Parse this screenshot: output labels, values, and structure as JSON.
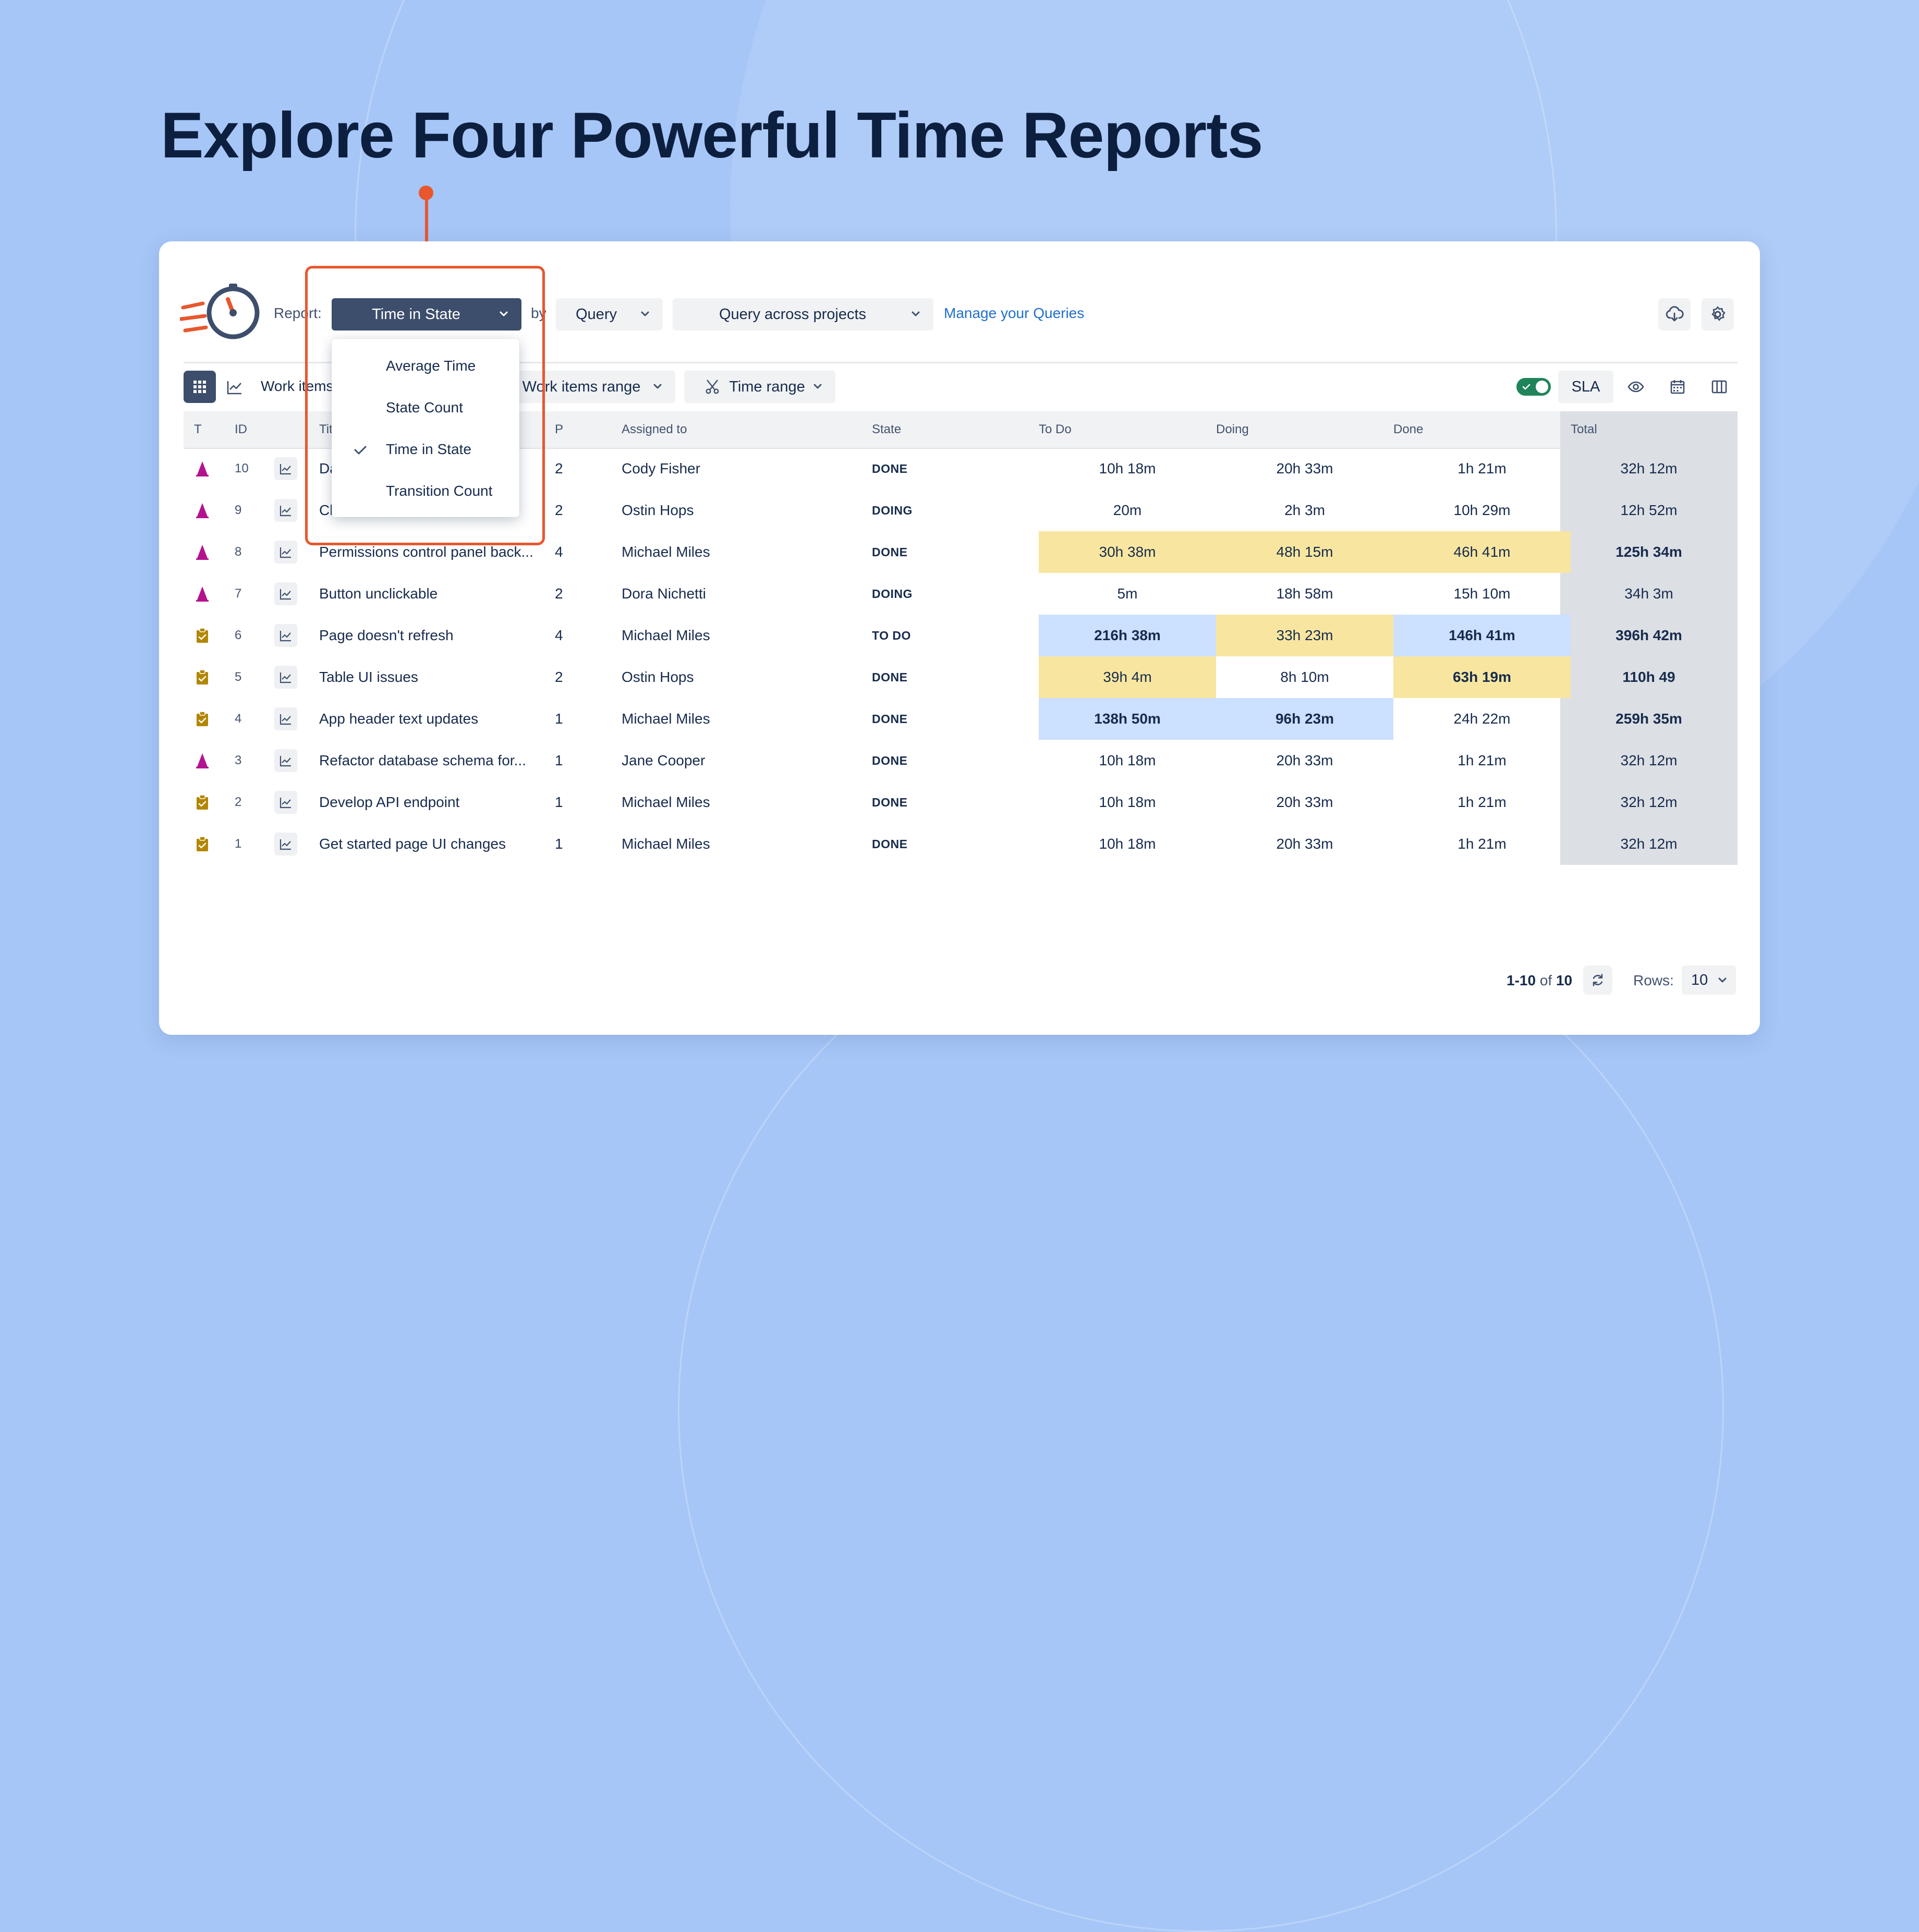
{
  "headline": "Explore Four Powerful Time Reports",
  "toolbar": {
    "report_label": "Report:",
    "report_value": "Time in State",
    "by_label": "by",
    "source_value": "Query",
    "query_value": "Query across projects",
    "manage_link": "Manage your Queries"
  },
  "filters": {
    "work_items_label": "Work items",
    "work_items_range": "Work items range",
    "time_range": "Time range",
    "sla_label": "SLA",
    "sla_enabled": true
  },
  "report_menu": {
    "items": [
      "Average Time",
      "State Count",
      "Time in State",
      "Transition Count"
    ],
    "selected": "Time in State"
  },
  "table": {
    "columns": {
      "type": "T",
      "id": "ID",
      "title": "Title",
      "priority": "P",
      "assignee": "Assigned to",
      "state": "State",
      "todo": "To Do",
      "doing": "Doing",
      "done": "Done",
      "total": "Total"
    },
    "rows": [
      {
        "type": "spike",
        "id": "10",
        "title": "Da",
        "p": "2",
        "assignee": "Cody Fisher",
        "state": "DONE",
        "todo": "10h 18m",
        "doing": "20h 33m",
        "done": "1h 21m",
        "total": "32h 12m",
        "bold": [],
        "hl": {}
      },
      {
        "type": "spike",
        "id": "9",
        "title": "Cl",
        "p": "2",
        "assignee": "Ostin Hops",
        "state": "DOING",
        "todo": "20m",
        "doing": "2h 3m",
        "done": "10h 29m",
        "total": "12h 52m",
        "bold": [],
        "hl": {}
      },
      {
        "type": "spike",
        "id": "8",
        "title": "Permissions control panel back...",
        "p": "4",
        "assignee": "Michael Miles",
        "state": "DONE",
        "todo": "30h 38m",
        "doing": "48h 15m",
        "done": "46h 41m",
        "total": "125h 34m",
        "bold": [
          "total"
        ],
        "hl": {
          "todo": "yellow",
          "doing": "yellow",
          "done": "yellow"
        }
      },
      {
        "type": "spike",
        "id": "7",
        "title": "Button unclickable",
        "p": "2",
        "assignee": "Dora Nichetti",
        "state": "DOING",
        "todo": "5m",
        "doing": "18h 58m",
        "done": "15h 10m",
        "total": "34h 3m",
        "bold": [],
        "hl": {}
      },
      {
        "type": "task",
        "id": "6",
        "title": "Page doesn't refresh",
        "p": "4",
        "assignee": "Michael Miles",
        "state": "TO DO",
        "todo": "216h 38m",
        "doing": "33h 23m",
        "done": "146h 41m",
        "total": "396h 42m",
        "bold": [
          "todo",
          "done",
          "total"
        ],
        "hl": {
          "todo": "blue",
          "doing": "yellow",
          "done": "blue"
        }
      },
      {
        "type": "task",
        "id": "5",
        "title": "Table UI issues",
        "p": "2",
        "assignee": "Ostin Hops",
        "state": "DONE",
        "todo": "39h 4m",
        "doing": "8h 10m",
        "done": "63h 19m",
        "total": "110h 49",
        "bold": [
          "done",
          "total"
        ],
        "hl": {
          "todo": "yellow",
          "done": "yellow"
        }
      },
      {
        "type": "task",
        "id": "4",
        "title": "App header text updates",
        "p": "1",
        "assignee": "Michael Miles",
        "state": "DONE",
        "todo": "138h 50m",
        "doing": "96h 23m",
        "done": "24h 22m",
        "total": "259h 35m",
        "bold": [
          "todo",
          "doing",
          "total"
        ],
        "hl": {
          "todo": "blue",
          "doing": "blue"
        }
      },
      {
        "type": "spike",
        "id": "3",
        "title": "Refactor database schema for...",
        "p": "1",
        "assignee": "Jane Cooper",
        "state": "DONE",
        "todo": "10h 18m",
        "doing": "20h 33m",
        "done": "1h 21m",
        "total": "32h 12m",
        "bold": [],
        "hl": {}
      },
      {
        "type": "task",
        "id": "2",
        "title": "Develop API endpoint",
        "p": "1",
        "assignee": "Michael Miles",
        "state": "DONE",
        "todo": "10h 18m",
        "doing": "20h 33m",
        "done": "1h 21m",
        "total": "32h 12m",
        "bold": [],
        "hl": {}
      },
      {
        "type": "task",
        "id": "1",
        "title": "Get started page UI changes",
        "p": "1",
        "assignee": "Michael Miles",
        "state": "DONE",
        "todo": "10h 18m",
        "doing": "20h 33m",
        "done": "1h 21m",
        "total": "32h 12m",
        "bold": [],
        "hl": {}
      }
    ]
  },
  "pagination": {
    "range": "1-10",
    "of_label": "of",
    "total": "10",
    "rows_label": "Rows:",
    "rows_value": "10"
  },
  "colors": {
    "accent": "#e8572e",
    "primary_dark": "#3d4e6c",
    "highlight_yellow": "#f8e6a0",
    "highlight_blue": "#cce0ff",
    "total_column": "#dcdfe4",
    "spike_icon": "#b3128f",
    "task_icon": "#b38600",
    "link": "#1f6fd1"
  },
  "icons": [
    "stopwatch-logo-icon",
    "chevron-down-icon",
    "cloud-download-icon",
    "gear-icon",
    "grid-view-icon",
    "chart-view-icon",
    "scissors-icon",
    "check-icon",
    "eye-icon",
    "calendar-icon",
    "columns-icon",
    "refresh-icon",
    "spike-type-icon",
    "task-type-icon",
    "trend-chart-icon"
  ]
}
